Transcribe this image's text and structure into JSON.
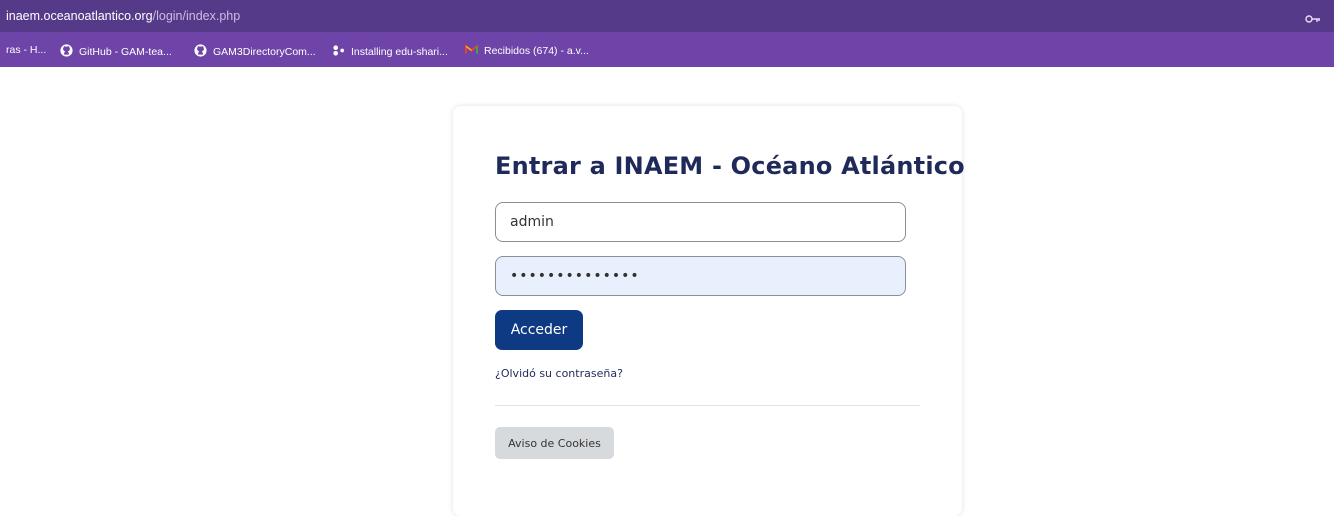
{
  "browser": {
    "url_host": "inaem.oceanoatlantico.org",
    "url_path": "/login/index.php",
    "key_icon": "key-icon"
  },
  "bookmarks": [
    {
      "label": "ras - H...",
      "icon": ""
    },
    {
      "label": "GitHub - GAM-tea...",
      "icon": "github-icon"
    },
    {
      "label": "GAM3DirectoryCom...",
      "icon": "github-icon"
    },
    {
      "label": "Installing edu-shari...",
      "icon": "share-icon"
    },
    {
      "label": "Recibidos (674) - a.v...",
      "icon": "gmail-icon"
    }
  ],
  "login": {
    "title": "Entrar a INAEM - Océano Atlántico",
    "username_value": "admin",
    "password_display": "••••••••••••••",
    "submit_label": "Acceder",
    "forgot_link": "¿Olvidó su contraseña?",
    "cookies_label": "Aviso de Cookies"
  },
  "colors": {
    "urlbar_bg": "#563a8a",
    "bookmarks_bg": "#6e44a8",
    "title": "#1f2a5a",
    "primary_button": "#0e3a84",
    "password_field_bg": "#e8f0fe"
  }
}
